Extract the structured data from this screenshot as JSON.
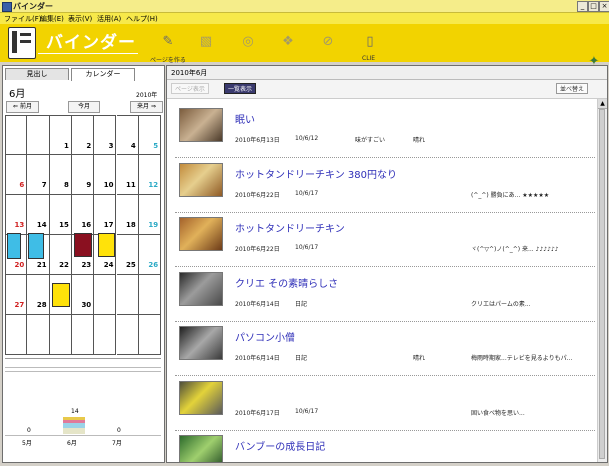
{
  "window": {
    "title": "バインダー",
    "controls": {
      "minimize": "_",
      "maximize": "□",
      "close": "×"
    }
  },
  "menu": {
    "items": [
      "ファイル(F)",
      "編集(E)",
      "表示(V)",
      "活用(A)",
      "ヘルプ(H)"
    ]
  },
  "toolbar": {
    "brand": "バインダー",
    "create_caption": "ページを作る",
    "clie_caption": "CLIE",
    "icons": [
      "edit-page-icon",
      "import-photo-icon",
      "search-icon",
      "stickers-icon",
      "attach-icon",
      "clie-device-icon",
      "magic-wand-icon"
    ]
  },
  "left": {
    "tabs": [
      "見出し",
      "カレンダー"
    ],
    "active_tab": "カレンダー",
    "month": "6月",
    "year": "2010年",
    "prev": "⇐ 前月",
    "today": "今月",
    "next": "来月 ⇒",
    "calendar": {
      "weeks": [
        [
          "",
          "",
          "1",
          "2",
          "3",
          "4",
          "5"
        ],
        [
          "6",
          "7",
          "8",
          "9",
          "10",
          "11",
          "12"
        ],
        [
          "13",
          "14",
          "15",
          "16",
          "17",
          "18",
          "19"
        ],
        [
          "20",
          "21",
          "22",
          "23",
          "24",
          "25",
          "26"
        ],
        [
          "27",
          "28",
          "29",
          "30",
          "",
          "",
          ""
        ],
        [
          "",
          "",
          "",
          "",
          "",
          "",
          ""
        ]
      ]
    },
    "mini_chart": {
      "counts": [
        "0",
        "14",
        "0"
      ],
      "months": [
        "5月",
        "6月",
        "7月"
      ]
    }
  },
  "right": {
    "header_date": "2010年6月",
    "page_view": "ページ表示",
    "list_view": "一覧表示",
    "sort": "並べ替え",
    "entries": [
      {
        "title": "眠い",
        "date": "2010年6月13日",
        "updated": "10/6/12",
        "tag": "味がすごい",
        "weather": "晴れ",
        "note": ""
      },
      {
        "title": "ホットタンドリーチキン 380円なり",
        "date": "2010年6月22日",
        "updated": "10/6/17",
        "tag": "",
        "weather": "",
        "note": "(^_^) 勝負にあ... ★★★★★"
      },
      {
        "title": "ホットタンドリーチキン",
        "date": "2010年6月22日",
        "updated": "10/6/17",
        "tag": "",
        "weather": "",
        "note": "ヾ(^▽^)ノ(^_^) 来... ♪♪♪♪♪♪"
      },
      {
        "title": "クリエ その素晴らしさ",
        "date": "2010年6月14日",
        "updated": "日記",
        "tag": "",
        "weather": "",
        "note": "クリエはパームの素..."
      },
      {
        "title": "パソコン小僧",
        "date": "2010年6月14日",
        "updated": "日記",
        "tag": "",
        "weather": "晴れ",
        "note": "梅雨時期家...テレビを見るよりもパ..."
      },
      {
        "title": "",
        "date": "2010年6月17日",
        "updated": "10/6/17",
        "tag": "",
        "weather": "",
        "note": "固い食べ物を思い..."
      },
      {
        "title": "バンブーの成長日記",
        "date": "",
        "updated": "",
        "tag": "",
        "weather": "",
        "note": ""
      }
    ]
  },
  "colors": {
    "toolbar_yellow": "#f2d300",
    "menu_yellow": "#f7e94a",
    "title_blue": "#2f2fb8",
    "sunday_red": "#d02020",
    "saturday_cyan": "#2aa9c5",
    "active_button": "#3a3a6e"
  }
}
